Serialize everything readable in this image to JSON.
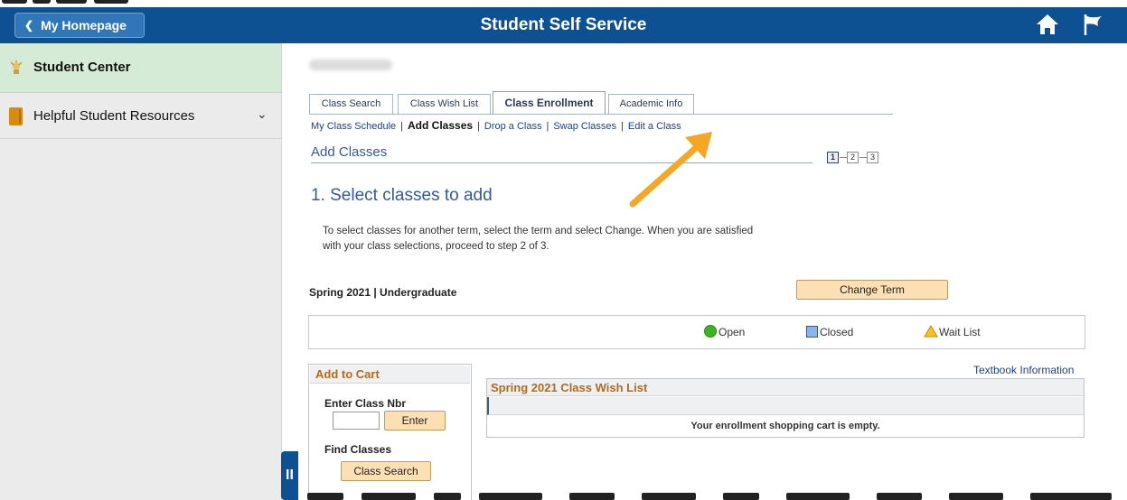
{
  "header": {
    "back_label": "My Homepage",
    "title": "Student Self Service",
    "brand_color": "#0d5193",
    "icons": [
      "home-icon",
      "flag-icon"
    ]
  },
  "sidebar": {
    "items": [
      {
        "label": "Student Center",
        "icon": "student-center-icon",
        "active": true
      },
      {
        "label": "Helpful Student Resources",
        "icon": "book-icon",
        "expandable": true
      }
    ]
  },
  "tabs": [
    {
      "label": "Class Search"
    },
    {
      "label": "Class Wish List"
    },
    {
      "label": "Class Enrollment",
      "active": true
    },
    {
      "label": "Academic Info"
    }
  ],
  "sublinks": {
    "schedule": "My Class Schedule",
    "add": "Add Classes",
    "drop": "Drop a Class",
    "swap": "Swap Classes",
    "edit": "Edit a Class",
    "separator": "|"
  },
  "page": {
    "heading": "Add Classes",
    "steps": [
      "1",
      "2",
      "3"
    ],
    "current_step": 1,
    "step_title": "1.  Select classes to add",
    "intro_line1": "To select classes for another term, select the term and select Change.  When you are satisfied",
    "intro_line2": "with your class selections, proceed to step 2 of 3."
  },
  "term": {
    "label": "Spring 2021 | Undergraduate",
    "change_button": "Change Term"
  },
  "legend": {
    "open": "Open",
    "closed": "Closed",
    "wait": "Wait List"
  },
  "cart": {
    "title": "Add to Cart",
    "enter_label": "Enter Class Nbr",
    "class_nbr_value": "",
    "enter_button": "Enter",
    "find_label": "Find Classes",
    "search_button": "Class Search"
  },
  "wishlist": {
    "textbook_link": "Textbook Information",
    "title": "Spring 2021 Class Wish List",
    "empty_message": "Your enrollment shopping cart is empty."
  },
  "colors": {
    "accent_orange": "#b36a1d",
    "button_bg": "#fce0b4",
    "arrow": "#f5a623"
  }
}
